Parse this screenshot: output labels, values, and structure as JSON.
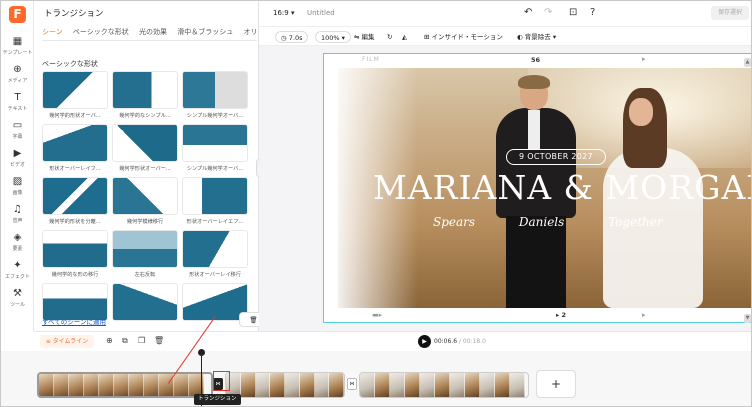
{
  "rail": {
    "items": [
      {
        "label": "テンプレート",
        "icon": "template-icon"
      },
      {
        "label": "メディア",
        "icon": "media-icon"
      },
      {
        "label": "テキスト",
        "icon": "text-icon"
      },
      {
        "label": "字幕",
        "icon": "subtitle-icon"
      },
      {
        "label": "ビデオ",
        "icon": "video-icon"
      },
      {
        "label": "画像",
        "icon": "image-icon"
      },
      {
        "label": "音声",
        "icon": "audio-icon"
      },
      {
        "label": "要素",
        "icon": "elements-icon"
      },
      {
        "label": "エフェクト",
        "icon": "effects-icon"
      },
      {
        "label": "ツール",
        "icon": "tools-icon"
      }
    ]
  },
  "panel": {
    "title": "トランジション",
    "tabs": [
      "シーン",
      "ベーシックな形状",
      "光の効果",
      "滑中＆ブラッシュ",
      "オリ"
    ],
    "section_title": "ベーシックな形状",
    "thumbs": [
      "幾何学的形状オーバ...",
      "幾何学的なシンプル...",
      "シンプル幾何学オーバ...",
      "形状オーバーレイフ...",
      "幾何学形状オーバー...",
      "シンプル幾何学オーバ...",
      "幾何学的形状を分離...",
      "幾何学模様移行",
      "形状オーバーレイエフ...",
      "幾何学的な形の移行",
      "左右反転",
      "形状オーバーレイ移行",
      "",
      "",
      ""
    ],
    "apply_all": "すべてのシーンに適用",
    "delete": "削除"
  },
  "topbar": {
    "ratio": "16:9",
    "title": "Untitled",
    "export": "保存選択"
  },
  "toolbar": {
    "duration": "7.0s",
    "zoom": "100%",
    "edit": "編集",
    "inside": "インサイド・モーション",
    "bg_remove": "背景除去"
  },
  "canvas": {
    "film": "FILM",
    "frame_top": "56",
    "frame_bottom": "2",
    "date": "9 OCTOBER 2027",
    "names": "MARIANA & MORGAN",
    "script": "Spears Daniels Together"
  },
  "timeline": {
    "label": "タイムライン",
    "current": "00:06.6",
    "total": "/ 00:18.0",
    "tooltip": "トランジション",
    "add": "+"
  }
}
